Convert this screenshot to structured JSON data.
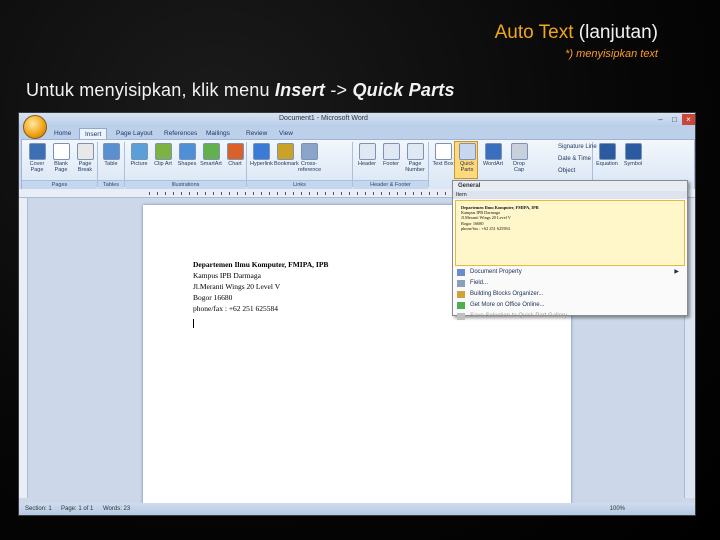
{
  "slide": {
    "title_accent": "Auto Text",
    "title_rest": "(lanjutan)",
    "subtitle": "*) menyisipkan text",
    "instruction_prefix": "Untuk menyisipkan, klik menu ",
    "instruction_insert": "Insert",
    "instruction_arrow": " -> ",
    "instruction_target": "Quick Parts"
  },
  "word": {
    "window_title": "Document1 - Microsoft Word",
    "tabs": [
      "Home",
      "Insert",
      "Page Layout",
      "References",
      "Mailings",
      "Review",
      "View"
    ],
    "active_tab": "Insert",
    "ribbon": {
      "buttons": [
        {
          "label": "Cover Page",
          "color": "#3d6fb4"
        },
        {
          "label": "Blank Page",
          "color": "#ffffff"
        },
        {
          "label": "Page Break",
          "color": "#e8e8e8"
        },
        {
          "label": "Table",
          "color": "#5a8fd0"
        },
        {
          "label": "Picture",
          "color": "#5aa0d8"
        },
        {
          "label": "Clip Art",
          "color": "#7cb342"
        },
        {
          "label": "Shapes",
          "color": "#4f8fd6"
        },
        {
          "label": "SmartArt",
          "color": "#63b14c"
        },
        {
          "label": "Chart",
          "color": "#d9622b"
        },
        {
          "label": "Hyperlink",
          "color": "#3a7bd5"
        },
        {
          "label": "Bookmark",
          "color": "#c9a227"
        },
        {
          "label": "Cross-reference",
          "color": "#8aa5c8"
        },
        {
          "label": "Header",
          "color": "#e0e8f4"
        },
        {
          "label": "Footer",
          "color": "#e0e8f4"
        },
        {
          "label": "Page Number",
          "color": "#e0e8f4"
        },
        {
          "label": "Text Box",
          "color": "#ffffff"
        },
        {
          "label": "Quick Parts",
          "color": "#c8d7ee"
        },
        {
          "label": "WordArt",
          "color": "#3a6fc0"
        },
        {
          "label": "Drop Cap",
          "color": "#c8d0dc"
        },
        {
          "label": "Equation",
          "color": "#2c5aa0"
        },
        {
          "label": "Symbol",
          "color": "#2c5aa0"
        }
      ],
      "groups": [
        "Pages",
        "Tables",
        "Illustrations",
        "Links",
        "Header & Footer"
      ],
      "small_items": [
        "Signature Line",
        "Date & Time",
        "Object"
      ]
    },
    "document_lines": [
      {
        "text": "Departemen Ilmu Komputer, FMIPA, IPB",
        "bold": true
      },
      {
        "text": "Kampus IPB Darmaga",
        "bold": false
      },
      {
        "text": "Jl.Meranti Wings 20 Level V",
        "bold": false
      },
      {
        "text": "Bogor 16680",
        "bold": false
      },
      {
        "text": "phone/fax : +62 251 625584",
        "bold": false
      }
    ],
    "dropdown": {
      "header": "General",
      "section_label": "Item",
      "preview_lines": [
        "Departemen Ilmu Komputer, FMIPA, IPB",
        "Kampus IPB Darmaga",
        "Jl.Meranti Wings 20 Level V",
        "Bogor 16680",
        "phone/fax : +62 251 625584"
      ],
      "items": [
        {
          "label": "Document Property",
          "submenu": true,
          "disabled": false
        },
        {
          "label": "Field...",
          "submenu": false,
          "disabled": false
        },
        {
          "label": "Building Blocks Organizer...",
          "submenu": false,
          "disabled": false
        },
        {
          "label": "Get More on Office Online...",
          "submenu": false,
          "disabled": false
        },
        {
          "label": "Save Selection to Quick Part Gallery...",
          "submenu": false,
          "disabled": true
        }
      ]
    },
    "status": {
      "section": "Section: 1",
      "page": "Page: 1 of 1",
      "words": "Words: 23",
      "zoom": "100%"
    }
  }
}
